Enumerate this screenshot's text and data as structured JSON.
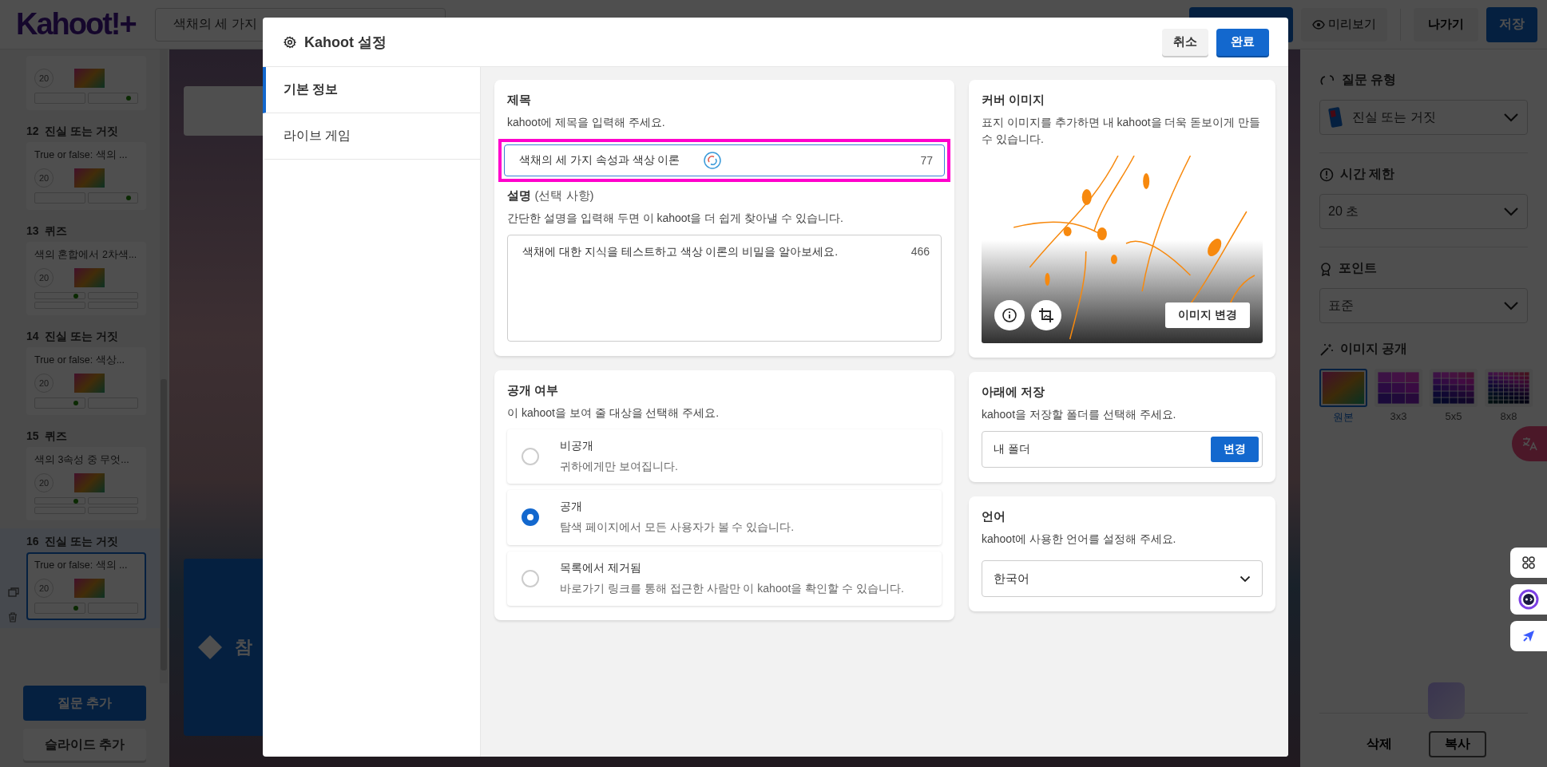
{
  "top_bar": {
    "logo": "Kahoot!+",
    "title_field": {
      "value": "색채의 세 가지"
    },
    "preview_button": "미리보기",
    "exit_button": "나가기",
    "save_button": "저장"
  },
  "slides": [
    {
      "time": "20",
      "kind": "true_false",
      "selected": false,
      "answers": [
        false,
        true
      ]
    },
    {
      "number": "12",
      "type_label": "진실 또는 거짓",
      "question": "True or false: 색의 ...",
      "time": "20",
      "kind": "true_false",
      "selected": false,
      "answers": [
        false,
        true
      ]
    },
    {
      "number": "13",
      "type_label": "퀴즈",
      "question": "색의 혼합에서 2차색...",
      "time": "20",
      "kind": "quiz",
      "selected": false,
      "answers": [
        true,
        false,
        false,
        false
      ]
    },
    {
      "number": "14",
      "type_label": "진실 또는 거짓",
      "question": "True or false: 색상...",
      "time": "20",
      "kind": "true_false",
      "selected": false,
      "answers": [
        true,
        false
      ]
    },
    {
      "number": "15",
      "type_label": "퀴즈",
      "question": "색의 3속성 중 무엇...",
      "time": "20",
      "kind": "quiz",
      "selected": false,
      "answers": [
        true,
        false,
        false,
        false
      ]
    },
    {
      "number": "16",
      "type_label": "진실 또는 거짓",
      "question": "True or false: 색의 ...",
      "time": "20",
      "kind": "true_false",
      "selected": true,
      "answers": [
        true,
        false
      ]
    }
  ],
  "sidebar_buttons": {
    "add_question": "질문 추가",
    "add_slide": "슬라이드 추가"
  },
  "canvas": {
    "answer_tile": {
      "label": "참"
    }
  },
  "right_panel": {
    "question_type": {
      "label": "질문 유형",
      "value": "진실 또는 거짓"
    },
    "time_limit": {
      "label": "시간 제한",
      "value": "20 초"
    },
    "points": {
      "label": "포인트",
      "value": "표준"
    },
    "image_reveal": {
      "label": "이미지 공개",
      "options": [
        {
          "label": "원본",
          "kind": "original",
          "selected": true
        },
        {
          "label": "3x3",
          "kind": "grid3",
          "selected": false
        },
        {
          "label": "5x5",
          "kind": "grid5",
          "selected": false
        },
        {
          "label": "8x8",
          "kind": "grid8",
          "selected": false
        }
      ]
    },
    "delete_button": "삭제",
    "copy_button": "복사"
  },
  "modal": {
    "title": "Kahoot 설정",
    "cancel_button": "취소",
    "done_button": "완료",
    "nav": [
      {
        "label": "기본 정보",
        "selected": true
      },
      {
        "label": "라이브 게임",
        "selected": false
      }
    ],
    "title_section": {
      "heading": "제목",
      "hint": "kahoot에 제목을 입력해 주세요.",
      "value": "색채의 세 가지 속성과 색상 이론",
      "count": "77"
    },
    "description_section": {
      "heading": "설명",
      "optional": "(선택 사항)",
      "hint": "간단한 설명을 입력해 두면 이 kahoot을 더 쉽게 찾아낼 수 있습니다.",
      "value": "색채에 대한 지식을 테스트하고 색상 이론의 비밀을 알아보세요.",
      "count": "466"
    },
    "visibility_section": {
      "heading": "공개 여부",
      "hint": "이 kahoot을 보여 줄 대상을 선택해 주세요.",
      "options": [
        {
          "label": "비공개",
          "description": "귀하에게만 보여집니다.",
          "selected": false
        },
        {
          "label": "공개",
          "description": "탐색 페이지에서 모든 사용자가 볼 수 있습니다.",
          "selected": true
        },
        {
          "label": "목록에서 제거됨",
          "description": "바로가기 링크를 통해 접근한 사람만 이 kahoot을 확인할 수 있습니다.",
          "selected": false
        }
      ]
    },
    "cover_section": {
      "heading": "커버 이미지",
      "hint": "표지 이미지를 추가하면 내 kahoot을 더욱 돋보이게 만들 수 있습니다.",
      "change_button": "이미지 변경"
    },
    "save_section": {
      "heading": "아래에 저장",
      "hint": "kahoot을 저장할 폴더를 선택해 주세요.",
      "folder": "내 폴더",
      "change_button": "변경"
    },
    "language_section": {
      "heading": "언어",
      "hint": "kahoot에 사용한 언어를 설정해 주세요.",
      "value": "한국어"
    }
  }
}
